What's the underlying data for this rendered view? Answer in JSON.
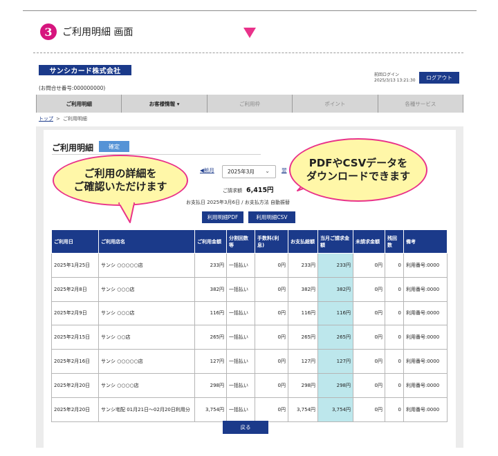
{
  "step": {
    "number": "3",
    "title": "ご利用明細 画面"
  },
  "header": {
    "logo_text": "サンシカード株式会社",
    "inquiry": "(お問合せ番号:000000000)",
    "last_login_label": "前回ログイン",
    "last_login_value": "2025/3/13 13:21:30",
    "logout_label": "ログアウト"
  },
  "nav": {
    "items": [
      {
        "label": "ご利用明細"
      },
      {
        "label": "お客様情報 ▾"
      },
      {
        "label": "ご利用枠"
      },
      {
        "label": "ポイント"
      },
      {
        "label": "各種サービス"
      }
    ]
  },
  "breadcrumb": {
    "home": "トップ",
    "sep": ">",
    "current": "ご利用明細"
  },
  "statement": {
    "title": "ご利用明細",
    "confirm_chip": "確定",
    "prev_label": "◀前月",
    "month": "2025年3月",
    "next_label": "翌",
    "billing_label": "ご請求額",
    "billing_amount": "6,415円",
    "payment_line": "お支払日 2025年3月6日 / お支払方法 自動振替",
    "pdf_button": "利用明細PDF",
    "csv_button": "利用明細CSV",
    "back_button": "戻る"
  },
  "callouts": {
    "left_line1": "ご利用の詳細を",
    "left_line2": "ご確認いただけます",
    "right_line1": "PDFやCSVデータを",
    "right_line2": "ダウンロードできます"
  },
  "table": {
    "headers": [
      "ご利用日",
      "ご利用店名",
      "ご利用金額",
      "分割回数等",
      "手数料(利息)",
      "お支払総額",
      "当月ご請求金額",
      "未請求金額",
      "残回数",
      "備考"
    ],
    "rows": [
      [
        "2025年1月25日",
        "サンシ ○○○○○店",
        "233円",
        "一括払い",
        "0円",
        "233円",
        "233円",
        "0円",
        "0",
        "利用番号:0000"
      ],
      [
        "2025年2月8日",
        "サンシ ○○○店",
        "382円",
        "一括払い",
        "0円",
        "382円",
        "382円",
        "0円",
        "0",
        "利用番号:0000"
      ],
      [
        "2025年2月9日",
        "サンシ ○○○店",
        "116円",
        "一括払い",
        "0円",
        "116円",
        "116円",
        "0円",
        "0",
        "利用番号:0000"
      ],
      [
        "2025年2月15日",
        "サンシ ○○店",
        "265円",
        "一括払い",
        "0円",
        "265円",
        "265円",
        "0円",
        "0",
        "利用番号:0000"
      ],
      [
        "2025年2月16日",
        "サンシ ○○○○○店",
        "127円",
        "一括払い",
        "0円",
        "127円",
        "127円",
        "0円",
        "0",
        "利用番号:0000"
      ],
      [
        "2025年2月20日",
        "サンシ ○○○○店",
        "298円",
        "一括払い",
        "0円",
        "298円",
        "298円",
        "0円",
        "0",
        "利用番号:0000"
      ],
      [
        "2025年2月20日",
        "サンシ宅配 01月21日～02月20日利用分",
        "3,754円",
        "一括払い",
        "0円",
        "3,754円",
        "3,754円",
        "0円",
        "0",
        "利用番号:0000"
      ]
    ]
  },
  "colors": {
    "brand_navy": "#1b3a8a",
    "step_magenta": "#d6157e",
    "callout_fill": "#fff7a8",
    "callout_border": "#e9328a",
    "highlight_cell": "#bde7ec"
  }
}
